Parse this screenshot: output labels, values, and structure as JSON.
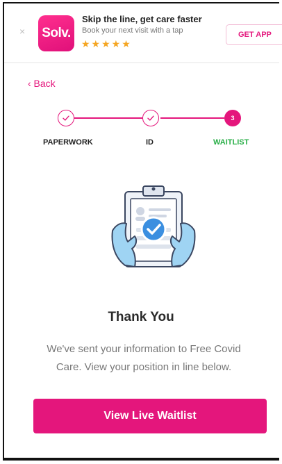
{
  "banner": {
    "close_glyph": "×",
    "logo_text": "Solv.",
    "title": "Skip the line, get care faster",
    "subtitle": "Book your next visit with a tap",
    "rating_stars": 5,
    "stars_text": "★★★★★",
    "get_app_label": "GET APP",
    "brand_color": "#e4167c",
    "star_color": "#f5a623"
  },
  "nav": {
    "back_label": "‹ Back"
  },
  "stepper": {
    "steps": [
      {
        "label": "PAPERWORK",
        "status": "complete",
        "icon": "check-icon"
      },
      {
        "label": "ID",
        "status": "complete",
        "icon": "check-icon"
      },
      {
        "label": "WAITLIST",
        "status": "current",
        "number": "3"
      }
    ],
    "accent_color": "#e4167c",
    "active_label_color": "#27ae46"
  },
  "illustration": {
    "icon": "clipboard-check-illustration"
  },
  "content": {
    "heading": "Thank You",
    "message": "We've sent your information to Free Covid Care. View your position in line below."
  },
  "cta": {
    "label": "View Live Waitlist"
  }
}
